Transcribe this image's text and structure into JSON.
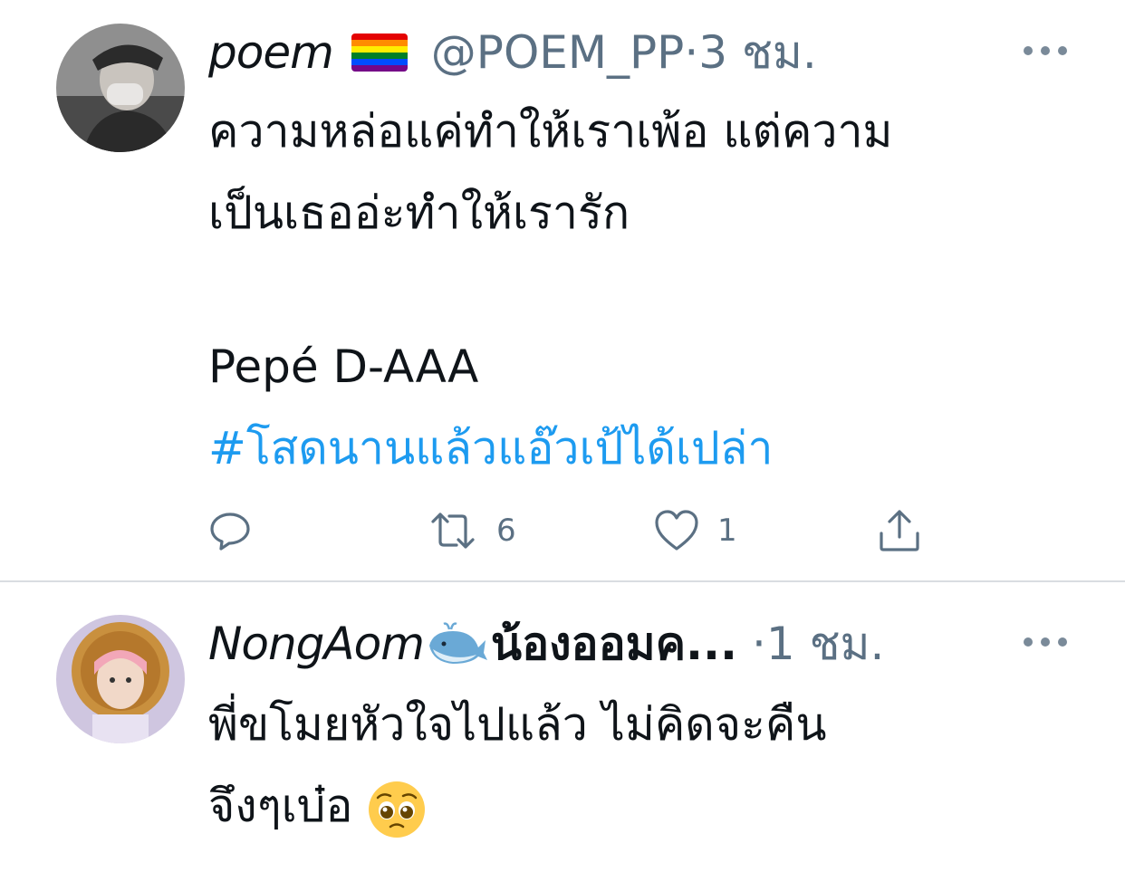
{
  "tweets": [
    {
      "display_name": "poem",
      "name_emoji": "rainbow-flag",
      "handle": "@POEM_PP",
      "separator": "·",
      "time": "3 ชม.",
      "text_line1": "ความหล่อแค่ทำให้เราเพ้อ แต่ความ",
      "text_line2": "เป็นเธออ่ะทำให้เรารัก",
      "text_line3": "Pepé D-AAA",
      "hashtag": "#โสดนานแล้วแอ๊วเป้ได้เปล่า",
      "actions": {
        "reply_icon": "reply-icon",
        "retweet_icon": "retweet-icon",
        "retweet_count": "6",
        "like_icon": "heart-icon",
        "like_count": "1",
        "share_icon": "share-icon"
      }
    },
    {
      "display_name": "NongAom",
      "name_emoji": "whale",
      "display_name_suffix": "น้องออมค...",
      "separator": "·",
      "time": "1 ชม.",
      "text_line1": "พี่ขโมยหัวใจไปแล้ว ไม่คิดจะคืน",
      "text_line2": "จึงๆเบ๋อ",
      "text_emoji": "pleading-face"
    }
  ],
  "colors": {
    "text": "#0f1419",
    "secondary": "#5b7083",
    "link": "#1d9bf0",
    "divider": "#d9dde1"
  }
}
